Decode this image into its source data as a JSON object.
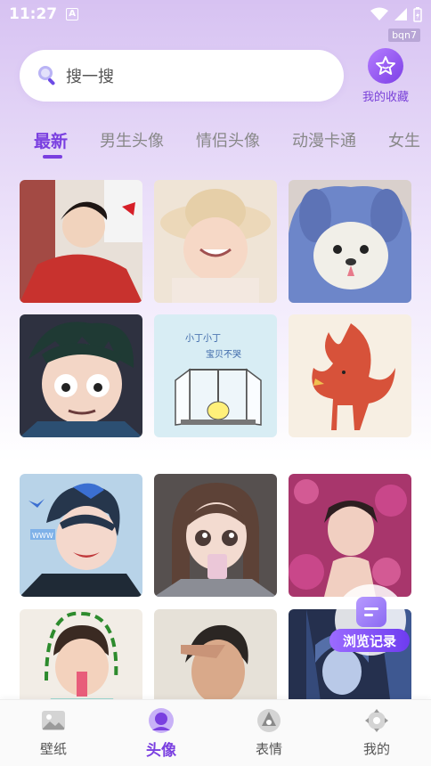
{
  "status_bar": {
    "time": "11:27",
    "a_badge": "A",
    "debug_tag": "bqn7"
  },
  "search": {
    "placeholder": "搜一搜"
  },
  "favorites": {
    "label": "我的收藏"
  },
  "tabs": [
    {
      "label": "最新",
      "active": true
    },
    {
      "label": "男生头像",
      "active": false
    },
    {
      "label": "情侣头像",
      "active": false
    },
    {
      "label": "动漫卡通",
      "active": false
    },
    {
      "label": "女生",
      "active": false
    }
  ],
  "tiles": [
    {
      "icon": "girl-red-sweater-photo"
    },
    {
      "icon": "toddler-sunhat-photo"
    },
    {
      "icon": "stitch-costume-dog-photo"
    },
    {
      "icon": "anime-boy-green-hair"
    },
    {
      "icon": "cartoon-window-chick",
      "text": [
        "小丁小丁",
        "宝贝不哭"
      ]
    },
    {
      "icon": "watercolor-fox"
    },
    {
      "icon": "anime-boy-blue-hair",
      "text": "WWW"
    },
    {
      "icon": "anime-girl-drinking"
    },
    {
      "icon": "girl-pink-flowers-photo"
    },
    {
      "icon": "child-drinking-photo"
    },
    {
      "icon": "man-saluting-photo"
    },
    {
      "icon": "blue-fantasy-figure"
    }
  ],
  "browse_history": {
    "label": "浏览记录"
  },
  "bottom_nav": [
    {
      "label": "壁纸",
      "icon": "wallpaper-icon",
      "active": false
    },
    {
      "label": "头像",
      "icon": "avatar-icon",
      "active": true
    },
    {
      "label": "表情",
      "icon": "emoji-icon",
      "active": false
    },
    {
      "label": "我的",
      "icon": "profile-icon",
      "active": false
    }
  ],
  "colors": {
    "accent": "#7a3fe0",
    "inactive": "#888888"
  }
}
